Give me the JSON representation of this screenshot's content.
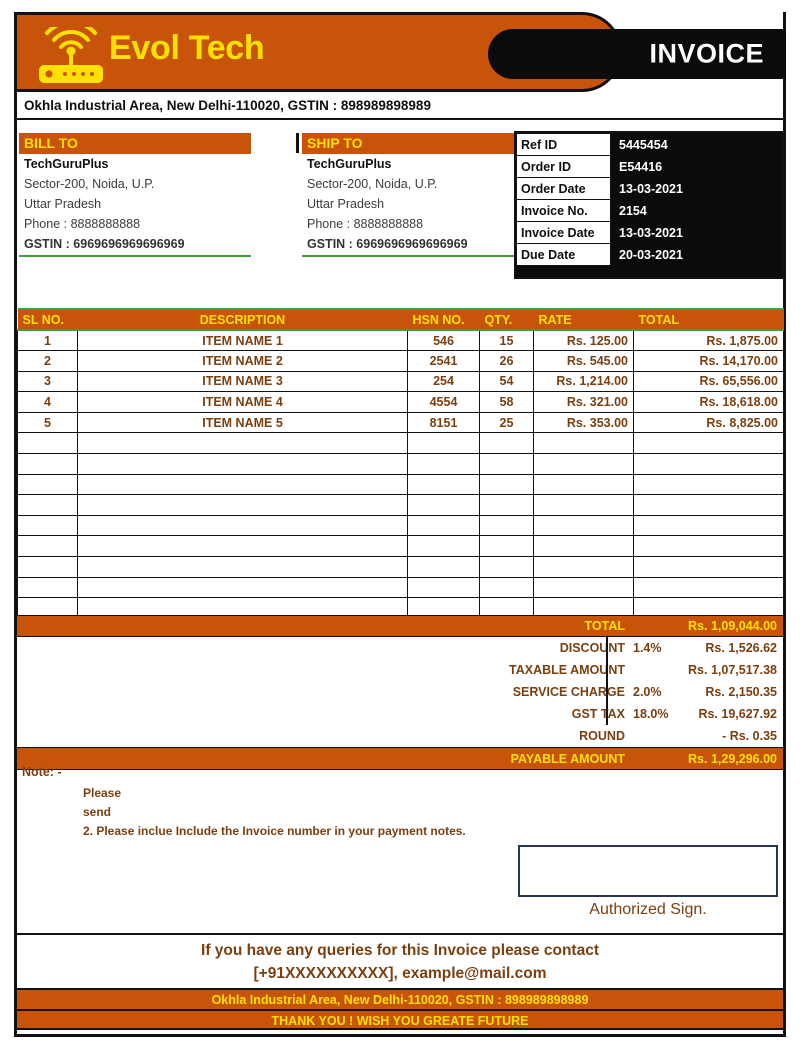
{
  "colors": {
    "orange": "#C8540A",
    "yellow": "#FFE000",
    "black": "#0b0b0b",
    "brown_text": "#7B3F10",
    "green_rule": "#3aa33a",
    "sign_border": "#24375f"
  },
  "header": {
    "brand": "Evol Tech",
    "logo_icon": "wifi-router-icon",
    "doc_title": "INVOICE",
    "company_address": "Okhla Industrial Area, New Delhi-110020, GSTIN : 898989898989"
  },
  "bill_to": {
    "heading": "BILL TO",
    "name": "TechGuruPlus",
    "address1": "Sector-200, Noida, U.P.",
    "address2": "Uttar Pradesh",
    "phone": "Phone : 8888888888",
    "gstin": "GSTIN : 6969696969696969"
  },
  "ship_to": {
    "heading": "SHIP TO",
    "name": "TechGuruPlus",
    "address1": "Sector-200, Noida, U.P.",
    "address2": "Uttar Pradesh",
    "phone": "Phone : 8888888888",
    "gstin": "GSTIN : 6969696969696969"
  },
  "ref_table": {
    "rows": [
      {
        "key": "Ref ID",
        "value": "5445454"
      },
      {
        "key": "Order ID",
        "value": "E54416"
      },
      {
        "key": "Order Date",
        "value": "13-03-2021"
      },
      {
        "key": "Invoice No.",
        "value": "2154"
      },
      {
        "key": "Invoice Date",
        "value": "13-03-2021"
      },
      {
        "key": "Due Date",
        "value": "20-03-2021"
      }
    ]
  },
  "items_table": {
    "headers": [
      "SL NO.",
      "DESCRIPTION",
      "HSN NO.",
      "QTY.",
      "RATE",
      "TOTAL"
    ],
    "rows": [
      {
        "sl": "1",
        "desc": "ITEM NAME 1",
        "hsn": "546",
        "qty": "15",
        "rate": "Rs. 125.00",
        "total": "Rs. 1,875.00"
      },
      {
        "sl": "2",
        "desc": "ITEM NAME 2",
        "hsn": "2541",
        "qty": "26",
        "rate": "Rs. 545.00",
        "total": "Rs. 14,170.00"
      },
      {
        "sl": "3",
        "desc": "ITEM NAME 3",
        "hsn": "254",
        "qty": "54",
        "rate": "Rs. 1,214.00",
        "total": "Rs. 65,556.00"
      },
      {
        "sl": "4",
        "desc": "ITEM NAME 4",
        "hsn": "4554",
        "qty": "58",
        "rate": "Rs. 321.00",
        "total": "Rs. 18,618.00"
      },
      {
        "sl": "5",
        "desc": "ITEM NAME 5",
        "hsn": "8151",
        "qty": "25",
        "rate": "Rs. 353.00",
        "total": "Rs. 8,825.00"
      }
    ],
    "empty_row_count": 9
  },
  "totals": {
    "total_label": "TOTAL",
    "total_value": "Rs. 1,09,044.00",
    "lines": [
      {
        "label": "DISCOUNT",
        "pct": "1.4%",
        "value": "Rs. 1,526.62"
      },
      {
        "label": "TAXABLE AMOUNT",
        "pct": "",
        "value": "Rs. 1,07,517.38"
      },
      {
        "label": "SERVICE CHARGE",
        "pct": "2.0%",
        "value": "Rs. 2,150.35"
      },
      {
        "label": "GST TAX",
        "pct": "18.0%",
        "value": "Rs. 19,627.92"
      },
      {
        "label": "ROUND",
        "pct": "",
        "value": "- Rs. 0.35"
      }
    ],
    "payable_label": "PAYABLE AMOUNT",
    "payable_value": "Rs. 1,29,296.00"
  },
  "note": {
    "title": "Note: -",
    "line1": "Please",
    "line2": "send",
    "line3": "2. Please inclue Include the Invoice number in your payment notes.",
    "sign_label": "Authorized Sign."
  },
  "footer": {
    "queries_line1": "If you have any queries for this Invoice  please contact",
    "queries_line2": "[+91XXXXXXXXXX], example@mail.com",
    "address_bar": "Okhla Industrial Area, New Delhi-110020, GSTIN : 898989898989",
    "thanks_bar": "THANK YOU ! WISH YOU GREATE FUTURE"
  }
}
